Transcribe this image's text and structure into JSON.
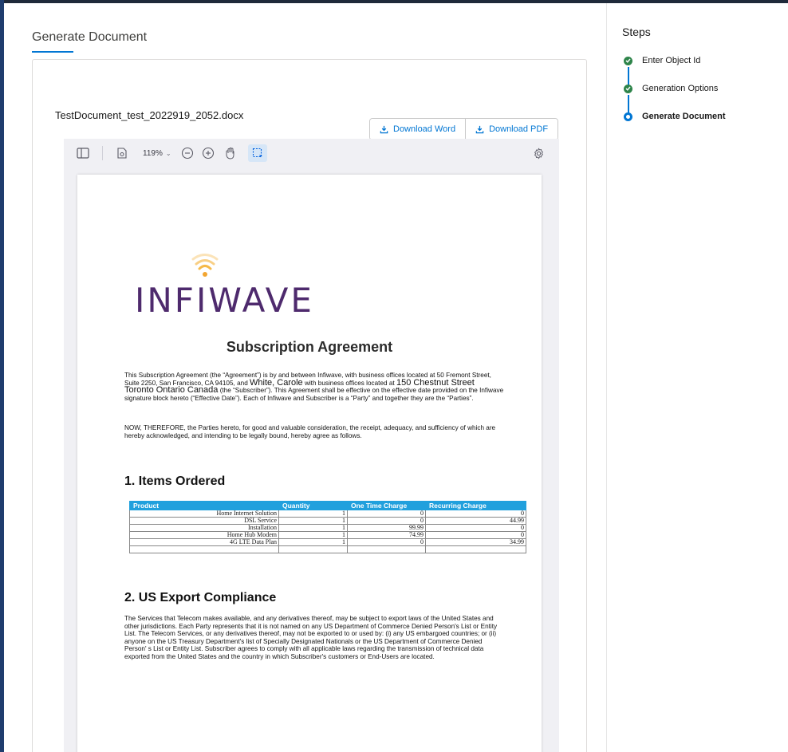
{
  "page": {
    "title": "Generate Document"
  },
  "document": {
    "filename": "TestDocument_test_2022919_2052.docx",
    "download_word": "Download Word",
    "download_pdf": "Download PDF"
  },
  "viewer": {
    "zoom": "119%"
  },
  "doc": {
    "logo_text": "INFIWAVE",
    "title": "Subscription Agreement",
    "intro_a": "This Subscription Agreement (the “Agreement”) is by and between Infiwave, with business offices located at 50 Fremont Street, Suite 2250, San Francisco, CA 94105, and ",
    "intro_name": "White,  Carole",
    "intro_b": " with business offices located at ",
    "intro_address": "150  Chestnut  Street Toronto Ontario  Canada",
    "intro_c": " (the “Subscriber”). This Agreement shall be effective on the effective date provided on the Infiwave signature block hereto (“Effective Date”). Each of Infiwave and Subscriber is a “Party” and together they are the “Parties”.",
    "now_therefore": "NOW, THEREFORE, the Parties hereto, for good and valuable consideration, the receipt, adequacy, and sufficiency of which are hereby acknowledged, and intending to be legally bound, hereby agree as follows.",
    "section1": "1. Items Ordered",
    "section2": "2. US Export Compliance",
    "export_text": "The Services that Telecom makes available, and any derivatives thereof, may be subject to export laws of the United States and other jurisdictions. Each Party represents that it is not named on any US Department of Commerce Denied Person's List or Entity List. The Telecom Services, or any derivatives thereof, may not be exported to or used by: (i) any US embargoed countries; or (ii) anyone on the US Treasury Department's list of Specially Designated Nationals or the US Department of Commerce Denied Person' s List or Entity List. Subscriber agrees to comply with all applicable laws regarding the transmission of technical data exported from the United States and the country in which Subscriber's customers or End-Users are located.",
    "table": {
      "headers": [
        "Product",
        "Quantity",
        "One Time Charge",
        "Recurring Charge"
      ],
      "rows": [
        [
          "Home Internet Solution",
          "1",
          "0",
          "0"
        ],
        [
          "DSL Service",
          "1",
          "0",
          "44.99"
        ],
        [
          "Installation",
          "1",
          "99.99",
          "0"
        ],
        [
          "Home Hub Modem",
          "1",
          "74.99",
          "0"
        ],
        [
          "4G LTE Data Plan",
          "1",
          "0",
          "34.99"
        ],
        [
          "",
          "",
          "",
          ""
        ]
      ]
    }
  },
  "steps": {
    "title": "Steps",
    "items": [
      {
        "label": "Enter Object Id",
        "state": "done"
      },
      {
        "label": "Generation Options",
        "state": "done"
      },
      {
        "label": "Generate Document",
        "state": "current"
      }
    ]
  },
  "colors": {
    "accent": "#0176d3",
    "complete": "#2e844a",
    "table_header": "#21a0dd",
    "logo": "#4e2a6d",
    "logo_wifi": "#f2a531"
  }
}
